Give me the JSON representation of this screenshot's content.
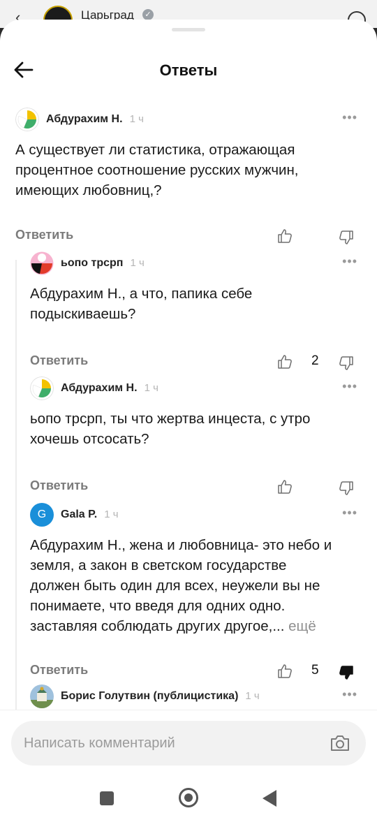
{
  "background_app": {
    "channel_name": "Царьград",
    "back_icon": "chevron-left-icon",
    "verified_icon": "check-badge-icon"
  },
  "header": {
    "title": "Ответы",
    "back_icon": "arrow-left-icon"
  },
  "comments": [
    {
      "author": "Абдурахим Н.",
      "time": "1 ч",
      "avatar": "yellow-green-blob-avatar",
      "text": "А существует ли статистика, отражающая\nпроцентное соотношение русских мужчин,\nимеющих любовниц,?",
      "more": "",
      "reply_label": "Ответить",
      "likes": "",
      "disliked": false
    },
    {
      "author": "ьопо трсрп",
      "time": "1 ч",
      "avatar": "pink-red-black-avatar",
      "text": "Абдурахим Н., а что, папика себе\nподыскиваешь?",
      "more": "",
      "reply_label": "Ответить",
      "likes": "2",
      "disliked": false
    },
    {
      "author": "Абдурахим Н.",
      "time": "1 ч",
      "avatar": "yellow-green-blob-avatar",
      "text": "ьопо трсрп, ты что жертва инцеста, с утро\nхочешь отсосать?",
      "more": "",
      "reply_label": "Ответить",
      "likes": "",
      "disliked": false
    },
    {
      "author": "Gala P.",
      "time": "1 ч",
      "avatar_letter": "G",
      "avatar": "blue-letter-avatar",
      "text": "Абдурахим Н., жена и любовница- это небо и\nземля, а закон в  светском государстве\nдолжен быть один для всех, неужели вы не\nпонимаете, что введя для одних одно.\nзаставляя соблюдать других другое,...",
      "more": "ещё",
      "reply_label": "Ответить",
      "likes": "5",
      "disliked": true
    },
    {
      "author": "Борис Голутвин (публицистика)",
      "time": "1 ч",
      "avatar": "church-photo-avatar"
    }
  ],
  "composer": {
    "placeholder": "Написать комментарий",
    "camera_icon": "camera-icon"
  },
  "colors": {
    "accent_blue": "#1a8fd9",
    "muted_text": "#7b7b7b",
    "time_text": "#b5b5b5"
  }
}
